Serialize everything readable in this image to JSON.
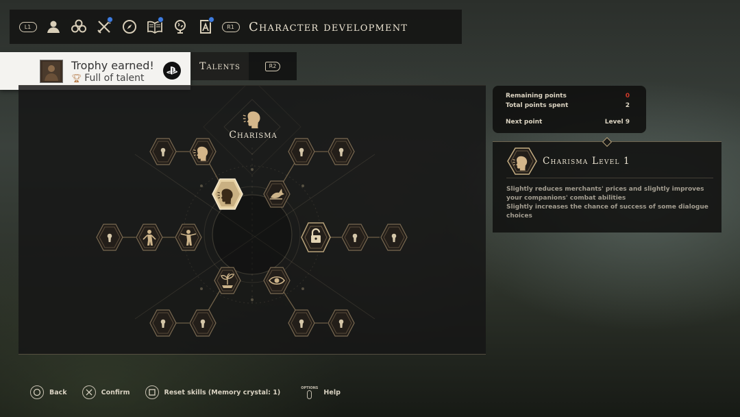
{
  "header": {
    "l1_label": "L1",
    "r1_label": "R1",
    "title": "Character development",
    "nav_icons": [
      {
        "name": "character-icon",
        "badge": false
      },
      {
        "name": "skills-icon",
        "badge": false
      },
      {
        "name": "weapons-icon",
        "badge": true
      },
      {
        "name": "compass-icon",
        "badge": false
      },
      {
        "name": "journal-icon",
        "badge": true
      },
      {
        "name": "map-globe-icon",
        "badge": false
      },
      {
        "name": "bestiary-icon",
        "badge": true
      }
    ],
    "badge_color": "#3f7ce0"
  },
  "trophy": {
    "title": "Trophy earned!",
    "name": "Full of talent",
    "icon": "bronze-trophy-icon"
  },
  "tabs": {
    "active_label": "Talents",
    "r2_label": "R2"
  },
  "tree": {
    "title": "Charisma",
    "nodes": [
      {
        "id": "top-left-lock",
        "state": "locked",
        "icon": "keyhole-icon"
      },
      {
        "id": "top-left-outer",
        "state": "owned",
        "icon": "charisma-voice-icon"
      },
      {
        "id": "top-right-lock-1",
        "state": "locked",
        "icon": "keyhole-icon"
      },
      {
        "id": "top-right-lock-2",
        "state": "locked",
        "icon": "keyhole-icon"
      },
      {
        "id": "charisma-selected",
        "state": "selected",
        "icon": "charisma-voice-icon"
      },
      {
        "id": "upper-right-inner",
        "state": "owned",
        "icon": "bird-hand-icon"
      },
      {
        "id": "mid-left-lock",
        "state": "locked",
        "icon": "keyhole-icon"
      },
      {
        "id": "mid-left-figure-1",
        "state": "owned",
        "icon": "figure-arms-icon"
      },
      {
        "id": "mid-left-figure-2",
        "state": "owned",
        "icon": "figure-arms-icon"
      },
      {
        "id": "mid-right-padlock",
        "state": "unlockable",
        "icon": "padlock-icon"
      },
      {
        "id": "mid-right-lock-1",
        "state": "locked",
        "icon": "keyhole-icon"
      },
      {
        "id": "mid-right-lock-2",
        "state": "locked",
        "icon": "keyhole-icon"
      },
      {
        "id": "lower-left-inner",
        "state": "owned",
        "icon": "plant-icon"
      },
      {
        "id": "lower-right-inner",
        "state": "owned",
        "icon": "eye-icon"
      },
      {
        "id": "bottom-left-lock-1",
        "state": "locked",
        "icon": "keyhole-icon"
      },
      {
        "id": "bottom-left-lock-2",
        "state": "locked",
        "icon": "keyhole-icon"
      },
      {
        "id": "bottom-right-lock-1",
        "state": "locked",
        "icon": "keyhole-icon"
      },
      {
        "id": "bottom-right-lock-2",
        "state": "locked",
        "icon": "keyhole-icon"
      }
    ]
  },
  "points": {
    "remaining_label": "Remaining points",
    "remaining_value": "0",
    "spent_label": "Total points spent",
    "spent_value": "2",
    "next_label": "Next point",
    "next_value": "Level 9",
    "alert_color": "#d03a2a"
  },
  "info": {
    "title": "Charisma Level 1",
    "line1": "Slightly reduces merchants' prices and slightly improves your companions' combat abilities",
    "line2": "Slightly increases the chance of success of some dialogue choices"
  },
  "footer": {
    "back": "Back",
    "confirm": "Confirm",
    "reset": "Reset skills (Memory crystal: 1)",
    "options_small": "OPTIONS",
    "help": "Help"
  }
}
